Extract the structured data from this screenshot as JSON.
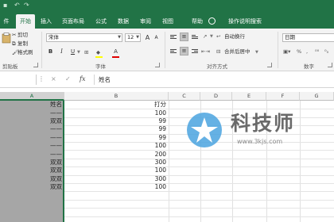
{
  "tabs": [
    {
      "label": "件"
    },
    {
      "label": "开始"
    },
    {
      "label": "插入"
    },
    {
      "label": "页面布局"
    },
    {
      "label": "公式"
    },
    {
      "label": "数据"
    },
    {
      "label": "审阅"
    },
    {
      "label": "视图"
    },
    {
      "label": "帮助"
    },
    {
      "label": "操作说明搜索"
    }
  ],
  "ribbon": {
    "clipboard": {
      "cut_label": "剪切",
      "copy_label": "复制",
      "format_painter_label": "格式刷",
      "group_label": "剪贴板"
    },
    "font": {
      "font_name": "宋体",
      "font_size": "12",
      "grow_label": "A",
      "shrink_label": "A",
      "bold": "B",
      "italic": "I",
      "underline": "U",
      "color_a": "A",
      "group_label": "字体"
    },
    "alignment": {
      "wrap_label": "自动换行",
      "merge_label": "合并后居中",
      "group_label": "对齐方式"
    },
    "number": {
      "format": "日期",
      "group_label": "数字"
    }
  },
  "formula_bar": {
    "cancel": "×",
    "enter": "✓",
    "fx": "fx",
    "content": "姓名"
  },
  "columns": [
    "A",
    "B",
    "C",
    "D",
    "E",
    "F",
    "G"
  ],
  "rows": [
    {
      "a": "姓名",
      "b": "打分"
    },
    {
      "a": "——",
      "b": "100"
    },
    {
      "a": "双双",
      "b": "99"
    },
    {
      "a": "——",
      "b": "99"
    },
    {
      "a": "——",
      "b": "99"
    },
    {
      "a": "——",
      "b": "100"
    },
    {
      "a": "——",
      "b": "200"
    },
    {
      "a": "双双",
      "b": "300"
    },
    {
      "a": "双双",
      "b": "100"
    },
    {
      "a": "双双",
      "b": "300"
    },
    {
      "a": "双双",
      "b": "100"
    }
  ],
  "watermark": {
    "title": "科技师",
    "url": "www.3kjs.com"
  },
  "colors": {
    "accent": "#217346",
    "selection": "#a6a6a6",
    "watermark_blue": "#4aa3df"
  },
  "icons": [
    "save-icon",
    "undo-icon",
    "redo-icon",
    "scissors-icon",
    "copy-icon",
    "format-painter-icon",
    "lightbulb-icon",
    "fill-color-icon",
    "watermark-logo-icon"
  ]
}
